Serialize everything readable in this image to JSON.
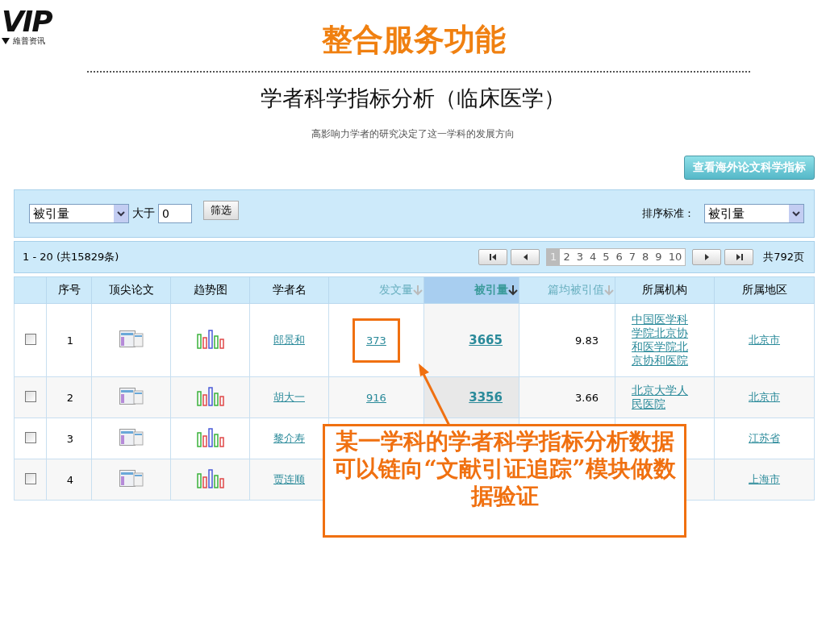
{
  "logo": {
    "mark": "VIP",
    "name": "維普资讯"
  },
  "title": "整合服务功能",
  "subtitle": "学者科学指标分析（临床医学）",
  "tagline": "高影响力学者的研究决定了这一学科的发展方向",
  "overseas_button": "查看海外论文科学指标",
  "filter": {
    "field": "被引量",
    "operator": "大于",
    "value": "0",
    "button": "筛选",
    "sort_label": "排序标准：",
    "sort_value": "被引量"
  },
  "pager": {
    "range": "1 - 20 (共15829条)",
    "total_pages": "共792页",
    "pages": [
      {
        "label": "1",
        "selected": true
      },
      {
        "label": "2",
        "selected": false
      },
      {
        "label": "3",
        "selected": false
      },
      {
        "label": "4",
        "selected": false
      },
      {
        "label": "5",
        "selected": false
      },
      {
        "label": "6",
        "selected": false
      },
      {
        "label": "7",
        "selected": false
      },
      {
        "label": "8",
        "selected": false
      },
      {
        "label": "9",
        "selected": false
      },
      {
        "label": "10",
        "selected": false
      }
    ]
  },
  "table": {
    "columns": [
      {
        "label": "序号",
        "kind": "plain",
        "selected": false
      },
      {
        "label": "顶尖论文",
        "kind": "plain",
        "selected": false
      },
      {
        "label": "趋势图",
        "kind": "plain",
        "selected": false
      },
      {
        "label": "学者名",
        "kind": "plain",
        "selected": false
      },
      {
        "label": "发文量",
        "kind": "sortable",
        "selected": false
      },
      {
        "label": "被引量",
        "kind": "sortable",
        "selected": true
      },
      {
        "label": "篇均被引值",
        "kind": "sortable",
        "selected": false
      },
      {
        "label": "所属机构",
        "kind": "plain",
        "selected": false
      },
      {
        "label": "所属地区",
        "kind": "plain",
        "selected": false
      }
    ],
    "rows": [
      {
        "checked": false,
        "index": "1",
        "name": "郎景和",
        "papers": "373",
        "papers_highlighted": true,
        "citations": "3665",
        "average": "9.83",
        "affiliation": "中国医学科学院北京协和医学院北京协和医院",
        "region": "北京市"
      },
      {
        "checked": false,
        "index": "2",
        "name": "胡大一",
        "papers": "916",
        "citations": "3356",
        "average": "3.66",
        "affiliation": "北京大学人民医院",
        "region": "北京市"
      },
      {
        "checked": false,
        "index": "3",
        "name": "黎介寿",
        "region": "江苏省"
      },
      {
        "checked": false,
        "index": "4",
        "name": "贾连顺",
        "region": "上海市"
      }
    ]
  },
  "callout": "某一学科的学者科学指标分析数据可以链向“文献引证追踪”模块做数据验证"
}
